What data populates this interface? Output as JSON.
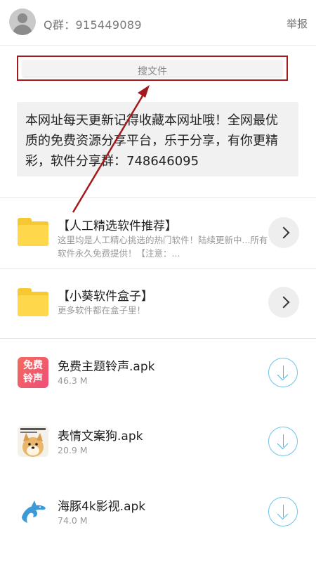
{
  "header": {
    "qgroup": "Q群：915449089",
    "report": "举报"
  },
  "search": {
    "placeholder": "搜文件"
  },
  "notice": {
    "text": "本网址每天更新记得收藏本网址哦！全网最优质的免费资源分享平台，乐于分享，有你更精彩，软件分享群：748646095"
  },
  "folders": [
    {
      "title": "【人工精选软件推荐】",
      "desc": "这里均是人工精心挑选的热门软件！陆续更新中...所有软件永久免费提供！【注意：..."
    },
    {
      "title": "【小葵软件盒子】",
      "desc": "更多软件都在盒子里！"
    }
  ],
  "files": [
    {
      "name": "免费主题铃声.apk",
      "size": "46.3 M",
      "icon_text": [
        "免费",
        "铃声"
      ]
    },
    {
      "name": "表情文案狗.apk",
      "size": "20.9 M"
    },
    {
      "name": "海豚4k影视.apk",
      "size": "74.0 M"
    }
  ],
  "colors": {
    "annotation": "#a31a1e",
    "folder": "#ffd74a",
    "download": "#4fb3e0"
  }
}
